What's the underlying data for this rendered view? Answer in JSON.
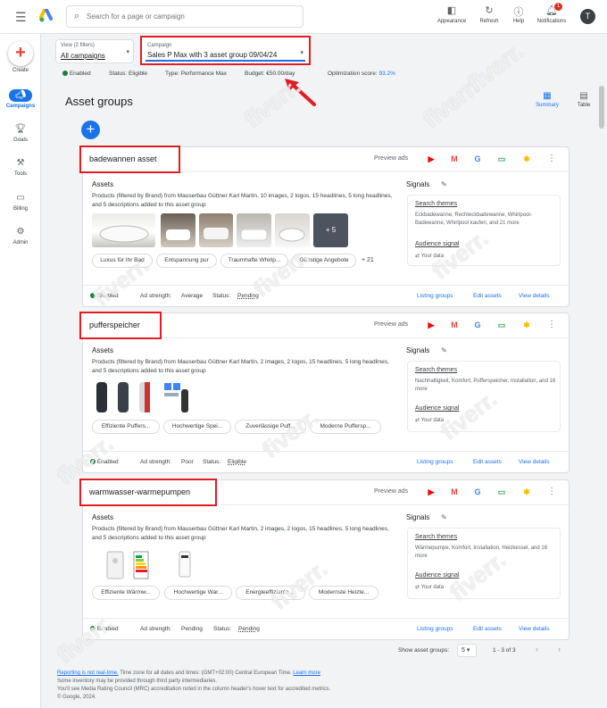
{
  "topbar": {
    "search_placeholder": "Search for a page or campaign",
    "actions": [
      {
        "label": "Appearance",
        "icon": "appearance-icon"
      },
      {
        "label": "Refresh",
        "icon": "refresh-icon"
      },
      {
        "label": "Help",
        "icon": "help-icon"
      },
      {
        "label": "Notifications",
        "icon": "bell-icon",
        "badge": "1"
      }
    ],
    "avatar_letter": "T"
  },
  "sidebar": {
    "create_label": "Create",
    "items": [
      {
        "label": "Campaigns",
        "icon": "megaphone-icon",
        "active": true
      },
      {
        "label": "Goals",
        "icon": "trophy-icon"
      },
      {
        "label": "Tools",
        "icon": "tools-icon"
      },
      {
        "label": "Billing",
        "icon": "card-icon"
      },
      {
        "label": "Admin",
        "icon": "gear-icon"
      }
    ]
  },
  "filters": {
    "view_label": "View (2 filters)",
    "view_value": "All campaigns",
    "campaign_label": "Campaign",
    "campaign_value": "Sales P Max with 3 asset group 09/04/24"
  },
  "status": {
    "enabled": "Enabled",
    "status": "Status: Eligible",
    "type": "Type: Performance Max",
    "budget": "Budget: €50.00/day",
    "opt_label": "Optimization score:",
    "opt_value": "93.2%"
  },
  "page": {
    "title": "Asset groups",
    "view_summary": "Summary",
    "view_table": "Table"
  },
  "cards": [
    {
      "name": "badewannen asset",
      "preview_ads": "Preview ads",
      "assets_title": "Assets",
      "assets_desc": "Products (filtered by Brand) from Mauserbau Güttner Karl Martin, 10 images, 2 logos, 15 headlines, 5 long headlines, and 5 descriptions added to this asset group",
      "thumb_more": "+ 5",
      "chips": [
        "Luxus für Ihr Bad",
        "Entspannung pur",
        "Traumhafte Whirlp...",
        "Günstige Angebote"
      ],
      "chips_more": "+ 21",
      "signals_title": "Signals",
      "search_themes": "Search themes",
      "themes_desc": "Eckbadewanne, Rechteckbadewanne, Whirlpool-Badewanne, Whirlpool kaufen, and 21 more",
      "audience": "Audience signal",
      "your_data": "Your data",
      "footer": {
        "enabled": "Enabled",
        "ad_strength_label": "Ad strength:",
        "ad_strength": "Average",
        "status_label": "Status:",
        "status": "Pending",
        "listing": "Listing groups",
        "edit": "Edit assets",
        "details": "View details"
      }
    },
    {
      "name": "pufferspeicher",
      "preview_ads": "Preview ads",
      "assets_title": "Assets",
      "assets_desc": "Products (filtered by Brand) from Mauserbau Güttner Karl Martin, 2 images, 2 logos, 15 headlines, 5 long headlines, and 5 descriptions added to this asset group",
      "chips": [
        "Effiziente Puffers...",
        "Hochwertige Spei...",
        "Zuverlässige Puff...",
        "Moderne Puffersp..."
      ],
      "signals_title": "Signals",
      "search_themes": "Search themes",
      "themes_desc": "Nachhaltigkeit, Komfort, Pufferspeicher, Installation, and 16 more",
      "audience": "Audience signal",
      "your_data": "Your data",
      "footer": {
        "enabled": "Enabled",
        "ad_strength_label": "Ad strength:",
        "ad_strength": "Poor",
        "status_label": "Status:",
        "status": "Eligible",
        "listing": "Listing groups",
        "edit": "Edit assets",
        "details": "View details"
      }
    },
    {
      "name": "warmwasser-warmepumpen",
      "preview_ads": "Preview ads",
      "assets_title": "Assets",
      "assets_desc": "Products (filtered by Brand) from Mauserbau Güttner Karl Martin, 2 images, 2 logos, 15 headlines, 5 long headlines, and 5 descriptions added to this asset group",
      "chips": [
        "Effiziente Wärmw...",
        "Hochwertige War...",
        "Energieeffiziente ...",
        "Modernste Heizte..."
      ],
      "signals_title": "Signals",
      "search_themes": "Search themes",
      "themes_desc": "Wärmepumpe, Komfort, Installation, Heizkessel, and 16 more",
      "audience": "Audience signal",
      "your_data": "Your data",
      "footer": {
        "enabled": "Enabled",
        "ad_strength_label": "Ad strength:",
        "ad_strength": "Pending",
        "status_label": "Status:",
        "status": "Pending",
        "listing": "Listing groups",
        "edit": "Edit assets",
        "details": "View details"
      }
    }
  ],
  "pagination": {
    "label": "Show asset groups:",
    "per_page": "5",
    "range": "1 - 3 of 3"
  },
  "footer": {
    "link1": "Reporting is not real-time.",
    "text1": " Time zone for all dates and times: (GMT+02:00) Central European Time.",
    "link2": "Learn more",
    "line2": "Some inventory may be provided through third party intermediaries.",
    "line3": "You'll see Media Rating Council (MRC) accreditation noted in the column header's hover text for accredited metrics.",
    "line4": "© Google, 2024."
  },
  "watermark_text": "fiverr.",
  "colors": {
    "accent": "#1a73e8",
    "highlight": "#e31b23",
    "enabled": "#188038"
  }
}
